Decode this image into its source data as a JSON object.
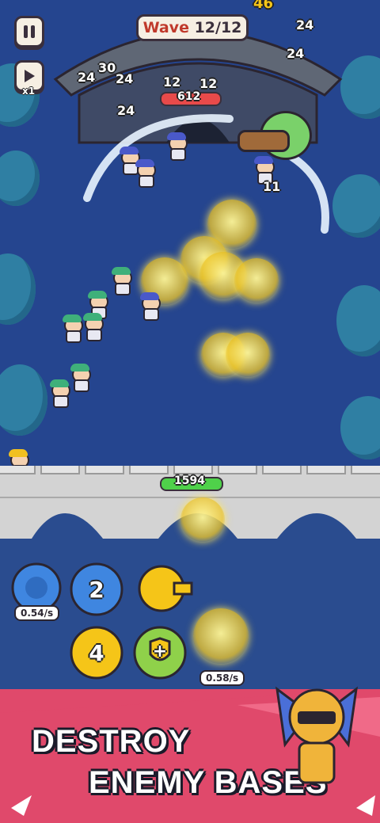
{
  "hud": {
    "pause_icon": "pause-icon",
    "speed_icon": "play-icon",
    "speed_label": "x1",
    "wave_prefix": "Wave",
    "wave_value": "12/12",
    "top_number": "46"
  },
  "damage_numbers": [
    "24",
    "30",
    "24",
    "24",
    "24",
    "24",
    "12",
    "12",
    "24",
    "11",
    "12"
  ],
  "enemy_boss": {
    "hp_text": "612"
  },
  "castle": {
    "hp_text": "1594"
  },
  "gears": [
    {
      "label": "",
      "rate": "0.54/s"
    },
    {
      "label": "2"
    },
    {
      "label": ""
    },
    {
      "label": "4"
    },
    {
      "label": "+"
    },
    {
      "label": "",
      "rate": "0.58/s"
    }
  ],
  "banner": {
    "line1": "DESTROY",
    "line2": "ENEMY BASES"
  },
  "colors": {
    "field": "#25458f",
    "hp_green": "#4fd14a",
    "hp_red": "#e84a4a",
    "banner_pink": "#e0496b",
    "gear_blue": "#3f86e0",
    "gear_yellow": "#f5c518",
    "gear_green": "#8fd14a"
  }
}
